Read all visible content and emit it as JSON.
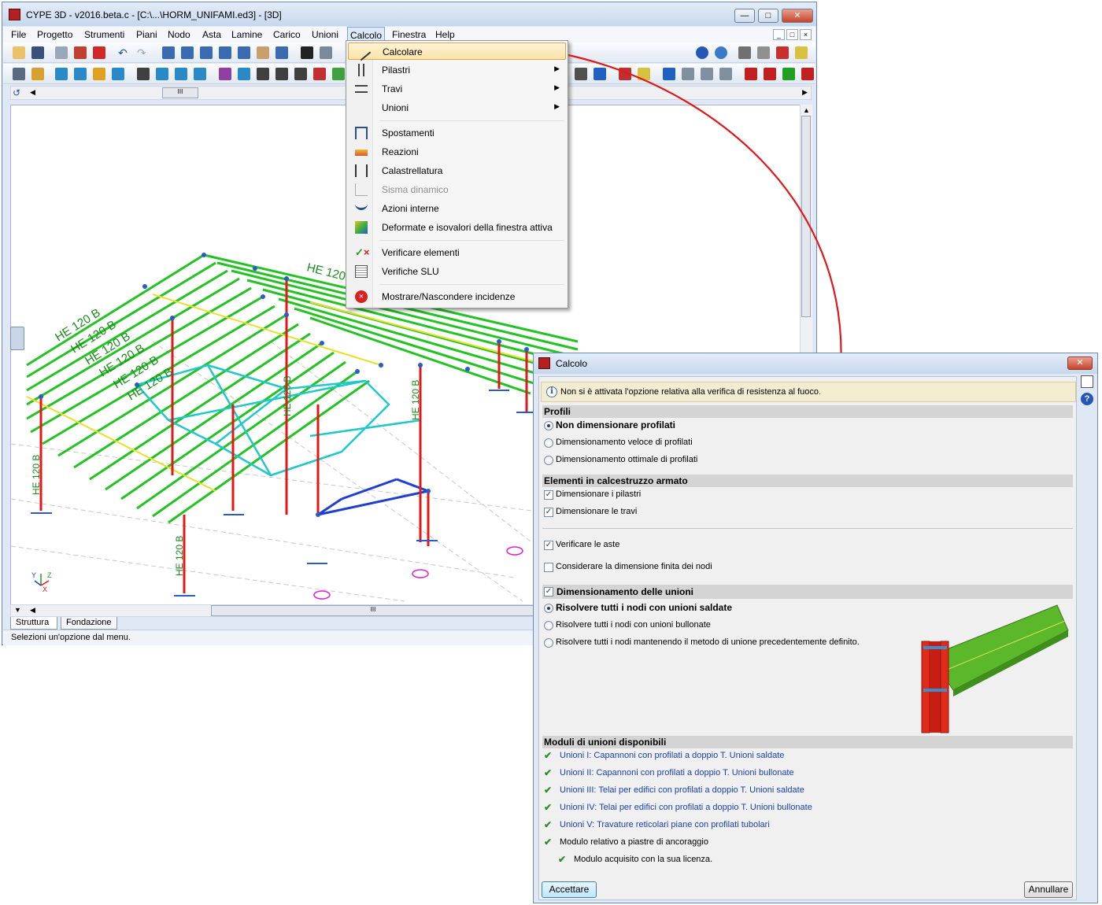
{
  "main_window": {
    "title": "CYPE 3D - v2016.beta.c - [C:\\...\\HORM_UNIFAMI.ed3] - [3D]",
    "menu": [
      "File",
      "Progetto",
      "Strumenti",
      "Piani",
      "Nodo",
      "Asta",
      "Lamine",
      "Carico",
      "Unioni",
      "Calcolo",
      "Finestra",
      "Help"
    ],
    "active_menu": "Calcolo",
    "tabs": [
      "Struttura",
      "Fondazione"
    ],
    "status": "Selezioni un'opzione dal menu.",
    "scroll_grip": "III",
    "axis_labels": {
      "z": "Z",
      "x": "X",
      "y": "Y"
    }
  },
  "calcolo_menu": {
    "items": [
      {
        "label": "Calcolare",
        "icon": "wand-icon",
        "highlighted": true
      },
      {
        "label": "Pilastri",
        "icon": "column-icon",
        "submenu": true
      },
      {
        "label": "Travi",
        "icon": "beam-icon",
        "submenu": true
      },
      {
        "label": "Unioni",
        "icon": "joint-icon",
        "submenu": true
      },
      {
        "label": "Spostamenti",
        "icon": "displacement-icon"
      },
      {
        "label": "Reazioni",
        "icon": "reactions-icon"
      },
      {
        "label": "Calastrellatura",
        "icon": "battens-icon"
      },
      {
        "label": "Sisma dinamico",
        "icon": "seismic-icon",
        "disabled": true
      },
      {
        "label": "Azioni interne",
        "icon": "internal-forces-icon"
      },
      {
        "label": "Deformate e isovalori della finestra attiva",
        "icon": "isovalues-icon"
      },
      {
        "label": "Verificare elementi",
        "icon": "check-elements-icon"
      },
      {
        "label": "Verifiche SLU",
        "icon": "slu-checks-icon"
      },
      {
        "label": "Mostrare/Nascondere incidenze",
        "icon": "incidences-icon"
      }
    ]
  },
  "dialog": {
    "title": "Calcolo",
    "info": "Non si è attivata l'opzione relativa alla verifica di resistenza al fuoco.",
    "profili": {
      "header": "Profili",
      "options": [
        "Non dimensionare profilati",
        "Dimensionamento veloce di profilati",
        "Dimensionamento ottimale di profilati"
      ],
      "selected": 0
    },
    "calcestruzzo": {
      "header": "Elementi in calcestruzzo armato",
      "checks": [
        {
          "label": "Dimensionare i pilastri",
          "checked": true
        },
        {
          "label": "Dimensionare le travi",
          "checked": true
        }
      ]
    },
    "verificare_aste": {
      "label": "Verificare le aste",
      "checked": true
    },
    "dimensione_finita": {
      "label": "Considerare la dimensione finita dei nodi",
      "checked": false
    },
    "unioni": {
      "header": "Dimensionamento delle unioni",
      "checked": true,
      "options": [
        "Risolvere tutti i nodi con unioni saldate",
        "Risolvere tutti i nodi con unioni bullonate",
        "Risolvere tutti i nodi mantenendo il metodo di unione precedentemente definito."
      ],
      "selected": 0
    },
    "moduli": {
      "header": "Moduli di unioni disponibili",
      "items": [
        "Unioni I: Capannoni con profilati a doppio T. Unioni saldate",
        "Unioni II: Capannoni con profilati a doppio T. Unioni bullonate",
        "Unioni III: Telai per edifici con profilati a doppio T. Unioni saldate",
        "Unioni IV: Telai per edifici con profilati a doppio T. Unioni bullonate",
        "Unioni V: Travature reticolari piane con profilati tubolari",
        "Modulo relativo a piastre di ancoraggio"
      ],
      "license_note": "Modulo acquisito con la sua licenza."
    },
    "buttons": {
      "accept": "Accettare",
      "cancel": "Annullare"
    }
  },
  "model_labels": {
    "beam_section": "HE 120 B"
  },
  "colors": {
    "beams": "#22c322",
    "columns": "#e01818",
    "bracing": "#20c8c8",
    "highlight": "#1e3fd0",
    "arrow": "#e01818"
  }
}
